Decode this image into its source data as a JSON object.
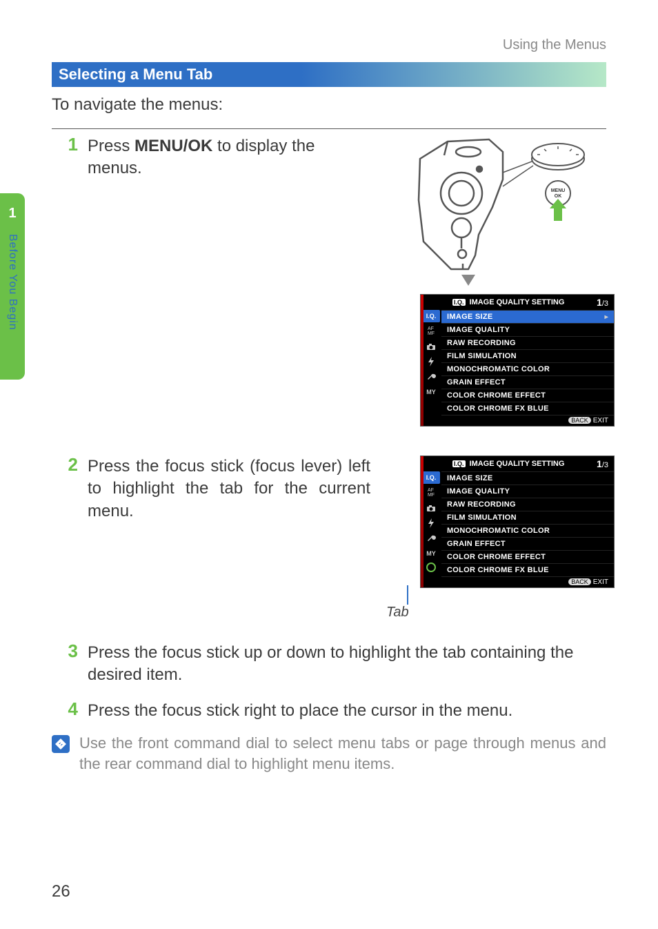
{
  "header": {
    "breadcrumb": "Using the Menus"
  },
  "sidebar": {
    "chapter": "1",
    "title": "Before You Begin"
  },
  "section": {
    "title": "Selecting a Menu Tab"
  },
  "intro": "To navigate the menus:",
  "steps": {
    "s1": {
      "num": "1",
      "text_before": "Press ",
      "menuok": "MENU/OK",
      "text_after": " to display the menus."
    },
    "s2": {
      "num": "2",
      "text": "Press the focus stick (focus lever) left to highlight the tab for the current menu."
    },
    "s3": {
      "num": "3",
      "text": "Press the focus stick up or down to highlight the tab containing the desired item."
    },
    "s4": {
      "num": "4",
      "text": "Press the focus stick right to place the cursor in the menu."
    }
  },
  "tip": {
    "text": "Use the front command dial to select menu tabs or page through menus and the rear command dial to highlight menu items."
  },
  "menu": {
    "header_icon": "I.Q.",
    "header_title": "IMAGE QUALITY SETTING",
    "page_current": "1",
    "page_total": "/3",
    "tabs": [
      "I.Q.",
      "AF MF",
      "cam",
      "flash",
      "wrench",
      "MY"
    ],
    "items": [
      "IMAGE SIZE",
      "IMAGE QUALITY",
      "RAW RECORDING",
      "FILM SIMULATION",
      "MONOCHROMATIC COLOR",
      "GRAIN EFFECT",
      "COLOR CHROME EFFECT",
      "COLOR CHROME FX BLUE"
    ],
    "footer_back": "BACK",
    "footer_exit": "EXIT"
  },
  "tab_caption": "Tab",
  "button_label": "MENU OK",
  "page_number": "26"
}
